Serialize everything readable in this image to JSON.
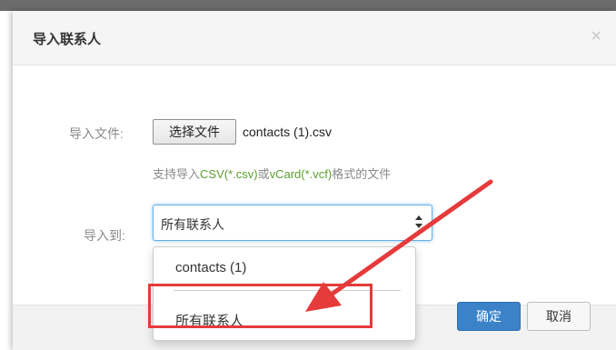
{
  "dialog": {
    "title": "导入联系人",
    "close_symbol": "×"
  },
  "form": {
    "file_label": "导入文件:",
    "choose_file_button": "选择文件",
    "file_name": "contacts (1).csv",
    "hint": {
      "part1": "支持导入",
      "csv": "CSV(*.csv)",
      "or": "或",
      "vcard": "vCard(*.vcf)",
      "part2": "格式的文件"
    },
    "target_label": "导入到:",
    "target_selected": "所有联系人"
  },
  "dropdown": {
    "options": [
      "contacts (1)",
      "所有联系人"
    ]
  },
  "footer": {
    "ok_label": "确定",
    "cancel_label": "取消"
  },
  "colors": {
    "accent": "#3b82c9",
    "hint_highlight": "#5a9e2f",
    "annotation": "#e53b3b",
    "focus_border": "#66afe9"
  },
  "icons": {
    "close": "close-icon",
    "select": "updown-arrows-icon"
  }
}
